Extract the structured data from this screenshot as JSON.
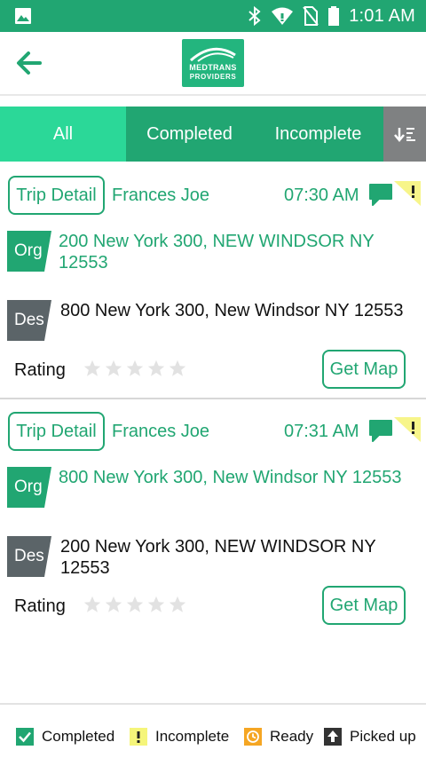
{
  "status_bar": {
    "time": "1:01 AM"
  },
  "header": {
    "logo_line1": "MEDTRANS",
    "logo_line2": "PROVIDERS"
  },
  "tabs": [
    {
      "label": "All",
      "active": true
    },
    {
      "label": "Completed",
      "active": false
    },
    {
      "label": "Incomplete",
      "active": false
    }
  ],
  "trips": [
    {
      "detail_label": "Trip Detail",
      "passenger": "Frances Joe",
      "time": "07:30 AM",
      "org_tag": "Org",
      "origin": "200 New York 300, NEW WINDSOR NY 12553",
      "des_tag": "Des",
      "destination": "800 New York 300, New Windsor NY 12553",
      "rating_label": "Rating",
      "rating": 0,
      "map_label": "Get Map"
    },
    {
      "detail_label": "Trip Detail",
      "passenger": "Frances Joe",
      "time": "07:31 AM",
      "org_tag": "Org",
      "origin": "800 New York 300, New Windsor NY 12553",
      "des_tag": "Des",
      "destination": "200 New York 300, NEW WINDSOR NY 12553",
      "rating_label": "Rating",
      "rating": 0,
      "map_label": "Get Map"
    }
  ],
  "legend": [
    {
      "label": "Completed",
      "icon": "check-icon",
      "color": "#21a672"
    },
    {
      "label": "Incomplete",
      "icon": "exclamation-icon",
      "color": "#f5f57a"
    },
    {
      "label": "Ready",
      "icon": "clock-icon",
      "color": "#f5a623"
    },
    {
      "label": "Picked up",
      "icon": "up-arrow-icon",
      "color": "#333333"
    }
  ],
  "colors": {
    "primary": "#21a672",
    "active_tab": "#2bd898",
    "dark": "#5b6468",
    "sort_bg": "#7f8182"
  }
}
